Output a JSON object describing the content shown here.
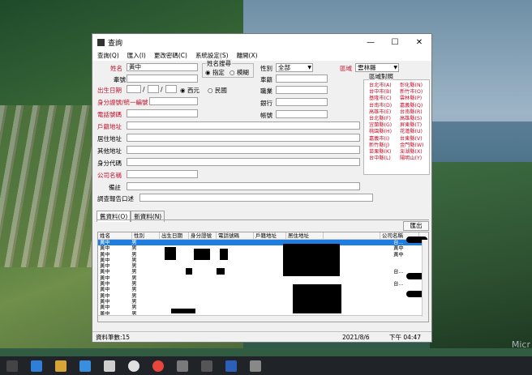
{
  "window": {
    "title": "查詢",
    "minimize": "—",
    "maximize": "☐",
    "close": "✕"
  },
  "menu": [
    "查詢(Q)",
    "匯入(I)",
    "更改密碼(C)",
    "系統設定(S)",
    "離開(X)"
  ],
  "form": {
    "name_label": "姓名",
    "name_value": "黃中",
    "related_label": "牽號",
    "name_search_group": "姓名搜尋",
    "opt_exact": "指定",
    "opt_fuzzy": "模糊",
    "gender_label": "性別",
    "gender_value": "全部",
    "region_label": "區域",
    "region_value": "雲林縣",
    "birthdate_label": "出生日期",
    "sep1": "/",
    "sep2": "/",
    "cal_ad": "西元",
    "cal_roc": "民國",
    "car_label": "車籍",
    "id_label": "身分證號/統一編號",
    "job_label": "職業",
    "phone_label": "電話號碼",
    "bank_label": "銀行",
    "household_label": "戶籍地址",
    "account_label": "帳號",
    "residence_label": "居住地址",
    "other_addr_label": "其他地址",
    "id_code_label": "身分代碼",
    "company_label": "公司名稱",
    "note_label": "備註",
    "report_label": "調查報告口述"
  },
  "region_ref": {
    "title": "區域對照",
    "col1": [
      "台北市(A)",
      "台中市(B)",
      "基隆市(C)",
      "台南市(D)",
      "高雄市(E)",
      "台北縣(F)",
      "宜蘭縣(G)",
      "桃園縣(H)",
      "嘉義市(I)",
      "新竹縣(J)",
      "苗栗縣(K)",
      "台中縣(L)"
    ],
    "col2": [
      "彰化縣(N)",
      "新竹市(O)",
      "雲林縣(P)",
      "嘉義縣(Q)",
      "台南縣(R)",
      "高雄縣(S)",
      "屏東縣(T)",
      "花蓮縣(U)",
      "台東縣(V)",
      "金門縣(W)",
      "澎湖縣(X)",
      "陽明山(Y)"
    ]
  },
  "tabs": [
    "舊資料(O)",
    "新資料(N)"
  ],
  "export_button": "匯出",
  "table": {
    "columns": [
      "姓名",
      "性別",
      "出生日期",
      "身分證號",
      "電話號碼",
      "戶籍地址",
      "居住地址",
      "",
      "公司名稱"
    ],
    "rows": [
      {
        "name": "黃中",
        "gender": "男",
        "company": "台..."
      },
      {
        "name": "黃中",
        "gender": "男",
        "company": "黃中"
      },
      {
        "name": "黃中",
        "gender": "男",
        "company": "黃中"
      },
      {
        "name": "黃中",
        "gender": "男",
        "company": ""
      },
      {
        "name": "黃中",
        "gender": "男",
        "company": ""
      },
      {
        "name": "黃中",
        "gender": "男",
        "company": "台..."
      },
      {
        "name": "黃中",
        "gender": "男",
        "company": ""
      },
      {
        "name": "黃中",
        "gender": "男",
        "company": "台..."
      },
      {
        "name": "黃中",
        "gender": "男",
        "company": ""
      },
      {
        "name": "黃中",
        "gender": "男",
        "company": ""
      },
      {
        "name": "黃中",
        "gender": "男",
        "company": ""
      },
      {
        "name": "黃中",
        "gender": "男",
        "company": ""
      },
      {
        "name": "黃中",
        "gender": "男",
        "company": ""
      },
      {
        "name": "黃中",
        "gender": "男",
        "company": ""
      }
    ]
  },
  "status": {
    "count": "資料筆數:15",
    "date": "2021/8/6",
    "time": "下午 04:47"
  },
  "watermark": "Micr"
}
